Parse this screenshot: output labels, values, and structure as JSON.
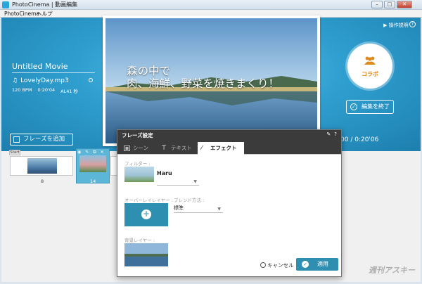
{
  "window": {
    "title": "PhotoCinema | 動画編集",
    "minimize": "–",
    "maximize": "□",
    "close": "✕"
  },
  "menu": {
    "items": [
      "PhotoCinema",
      "ヘルプ"
    ]
  },
  "stage": {
    "help_label": "操作説明",
    "help_icon_text": "?",
    "movie_title": "Untitled Movie",
    "music_file": "LovelyDay.mp3",
    "bpm": "120 BPM",
    "duration": "0:20'04",
    "bitrate": "AL41 秒",
    "add_phrase_label": "フレーズを追加",
    "time_readout": "00 / 0:20'06",
    "collab_label": "コラボ",
    "end_edit_label": "編集を終了"
  },
  "preview": {
    "caption_line1": "森の中で",
    "caption_line2": "肉、海鮮、野菜を焼きまくり！"
  },
  "timeline": {
    "start_label": "Start",
    "clip1_number": "8",
    "clip2_number": "14"
  },
  "dialog": {
    "title": "フレーズ設定",
    "tabs": [
      "シーン",
      "テキスト",
      "エフェクト"
    ],
    "active_tab_index": 2,
    "filter_label": "フィルター :",
    "filter_name": "Haru",
    "overlay_label": "オーバーレイレイヤー :",
    "blend_label": "ブレンド方法 :",
    "blend_value": "標準",
    "background_label": "背景レイヤー :",
    "cancel_label": "キャンセル",
    "apply_label": "適用"
  },
  "watermark": "週刊アスキー",
  "colors": {
    "accent": "#2f8fb0",
    "stage_teal": "#2f9fd0",
    "collab_orange": "#e08a1e"
  }
}
